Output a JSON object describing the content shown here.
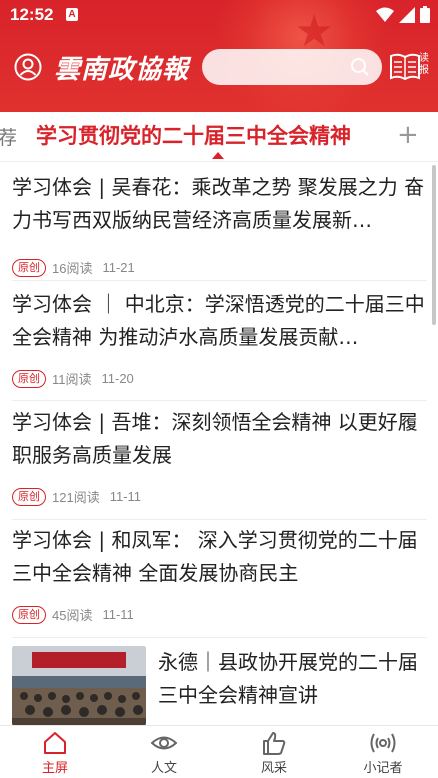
{
  "status_bar": {
    "time": "12:52",
    "app_icon_letter": "A"
  },
  "header": {
    "logo_text": "雲南政協報",
    "search": {
      "placeholder": "",
      "value": ""
    },
    "epaper_label": "读报",
    "icons": [
      "profile-icon",
      "search-icon",
      "epaper-icon"
    ]
  },
  "tabs": {
    "prev_partial": "荐",
    "active": "学习贯彻党的二十届三中全会精神",
    "add_symbol": "+"
  },
  "articles": [
    {
      "title": "学习体会 | 吴春花：乘改革之势 聚发展之力 奋力书写西双版纳民营经济高质量发展新…",
      "badge": "原创",
      "reads": "16阅读",
      "date": "11-21"
    },
    {
      "title": "学习体会 ｜ 中北京：学深悟透党的二十届三中全会精神  为推动泸水高质量发展贡献…",
      "badge": "原创",
      "reads": "11阅读",
      "date": "11-20"
    },
    {
      "title": "学习体会 | 吾堆：深刻领悟全会精神  以更好履职服务高质量发展",
      "badge": "原创",
      "reads": "121阅读",
      "date": "11-11"
    },
    {
      "title": "学习体会 | 和凤军：  深入学习贯彻党的二十届三中全会精神   全面发展协商民主",
      "badge": "原创",
      "reads": "45阅读",
      "date": "11-11"
    },
    {
      "title": "永德｜县政协开展党的二十届三中全会精神宣讲",
      "has_thumbnail": true
    }
  ],
  "bottom_nav": [
    {
      "label": "主屏",
      "icon": "home-icon",
      "active": true
    },
    {
      "label": "人文",
      "icon": "eye-icon",
      "active": false
    },
    {
      "label": "风采",
      "icon": "thumbs-up-icon",
      "active": false
    },
    {
      "label": "小记者",
      "icon": "broadcast-icon",
      "active": false
    }
  ],
  "colors": {
    "brand_red": "#d8232a",
    "text": "#222222",
    "meta": "#888888"
  }
}
